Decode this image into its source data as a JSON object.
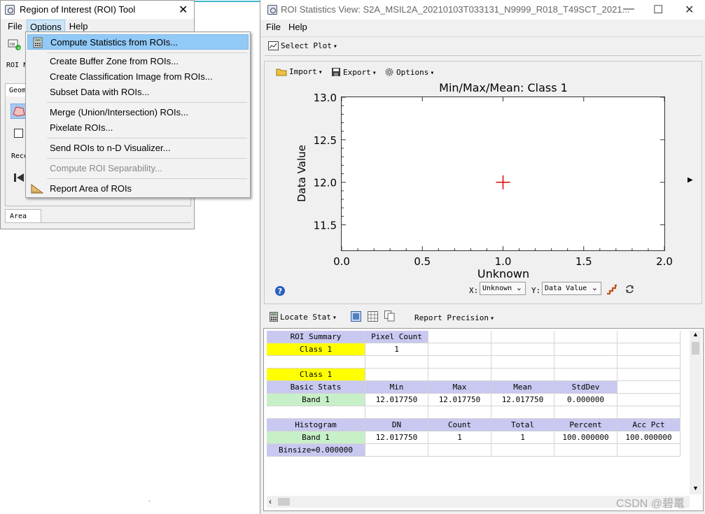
{
  "roi_tool": {
    "title": "Region of Interest (ROI) Tool",
    "menu": [
      "File",
      "Options",
      "Help"
    ],
    "roi_label": "ROI N",
    "tab_geom": "Geom",
    "recover_label": "Reco",
    "tab_area": "Area",
    "close_glyph": "✕"
  },
  "options_menu": {
    "items": [
      {
        "label": "Compute Statistics from ROIs...",
        "highlighted": true,
        "disabled": false,
        "icon": "calculator-icon"
      },
      {
        "label": "Create Buffer Zone from ROIs...",
        "highlighted": false,
        "disabled": false
      },
      {
        "label": "Create Classification Image from ROIs...",
        "highlighted": false,
        "disabled": false
      },
      {
        "label": "Subset Data with ROIs...",
        "highlighted": false,
        "disabled": false
      },
      {
        "label": "Merge (Union/Intersection) ROIs...",
        "highlighted": false,
        "disabled": false
      },
      {
        "label": "Pixelate ROIs...",
        "highlighted": false,
        "disabled": false
      },
      {
        "label": "Send ROIs to n-D Visualizer...",
        "highlighted": false,
        "disabled": false
      },
      {
        "label": "Compute ROI Separability...",
        "highlighted": false,
        "disabled": true
      },
      {
        "label": "Report Area of ROIs",
        "highlighted": false,
        "disabled": false,
        "icon": "ruler-icon"
      }
    ]
  },
  "stats_view": {
    "title": "ROI Statistics View: S2A_MSIL2A_20210103T033131_N9999_R018_T49SCT_2021...",
    "menu": [
      "File",
      "Help"
    ],
    "select_plot": "Select Plot",
    "plot_toolbar": {
      "import": "Import",
      "export": "Export",
      "options": "Options"
    },
    "x_label_prefix": "X:",
    "x_value": "Unknown",
    "y_label_prefix": "Y:",
    "y_value": "Data Value",
    "locate_stat": "Locate Stat",
    "report_precision": "Report Precision",
    "minimize": "—",
    "maximize": "☐",
    "close": "✕"
  },
  "chart_data": {
    "type": "scatter",
    "title": "Min/Max/Mean: Class 1",
    "xlabel": "Unknown",
    "ylabel": "Data Value",
    "xlim": [
      0.0,
      2.0
    ],
    "ylim": [
      11.2,
      13.0
    ],
    "xticks": [
      "0.0",
      "0.5",
      "1.0",
      "1.5",
      "2.0"
    ],
    "yticks": [
      "13.0",
      "12.5",
      "12.0",
      "11.5"
    ],
    "ytick_values": [
      13.0,
      12.5,
      12.0,
      11.5
    ],
    "xtick_values": [
      0.0,
      0.5,
      1.0,
      1.5,
      2.0
    ],
    "points": [
      {
        "x": 1.0,
        "y": 12.0,
        "marker": "+",
        "color": "#e00000"
      }
    ]
  },
  "table": {
    "rows": [
      [
        {
          "t": "ROI Summary",
          "c": "hdr"
        },
        {
          "t": "Pixel Count",
          "c": "hdr"
        },
        {
          "t": ""
        },
        {
          "t": ""
        },
        {
          "t": ""
        },
        {
          "t": ""
        }
      ],
      [
        {
          "t": "Class 1",
          "c": "yel"
        },
        {
          "t": "1"
        },
        {
          "t": ""
        },
        {
          "t": ""
        },
        {
          "t": ""
        },
        {
          "t": ""
        }
      ],
      [
        {
          "t": ""
        },
        {
          "t": ""
        },
        {
          "t": ""
        },
        {
          "t": ""
        },
        {
          "t": ""
        },
        {
          "t": ""
        }
      ],
      [
        {
          "t": "Class 1",
          "c": "yel"
        },
        {
          "t": ""
        },
        {
          "t": ""
        },
        {
          "t": ""
        },
        {
          "t": ""
        },
        {
          "t": ""
        }
      ],
      [
        {
          "t": "Basic Stats",
          "c": "hdr"
        },
        {
          "t": "Min",
          "c": "hdr"
        },
        {
          "t": "Max",
          "c": "hdr"
        },
        {
          "t": "Mean",
          "c": "hdr"
        },
        {
          "t": "StdDev",
          "c": "hdr"
        },
        {
          "t": ""
        }
      ],
      [
        {
          "t": "Band 1",
          "c": "grn"
        },
        {
          "t": "12.017750"
        },
        {
          "t": "12.017750"
        },
        {
          "t": "12.017750"
        },
        {
          "t": "0.000000"
        },
        {
          "t": ""
        }
      ],
      [
        {
          "t": ""
        },
        {
          "t": ""
        },
        {
          "t": ""
        },
        {
          "t": ""
        },
        {
          "t": ""
        },
        {
          "t": ""
        }
      ],
      [
        {
          "t": "Histogram",
          "c": "hdr"
        },
        {
          "t": "DN",
          "c": "hdr"
        },
        {
          "t": "Count",
          "c": "hdr"
        },
        {
          "t": "Total",
          "c": "hdr"
        },
        {
          "t": "Percent",
          "c": "hdr"
        },
        {
          "t": "Acc Pct",
          "c": "hdr"
        }
      ],
      [
        {
          "t": "Band 1",
          "c": "grn"
        },
        {
          "t": "12.017750"
        },
        {
          "t": "1"
        },
        {
          "t": "1"
        },
        {
          "t": "100.000000"
        },
        {
          "t": "100.000000"
        }
      ],
      [
        {
          "t": "Binsize=0.000000",
          "c": "hdr"
        },
        {
          "t": ""
        },
        {
          "t": ""
        },
        {
          "t": ""
        },
        {
          "t": ""
        },
        {
          "t": ""
        }
      ]
    ]
  },
  "watermark": "CSDN @碧鼍"
}
